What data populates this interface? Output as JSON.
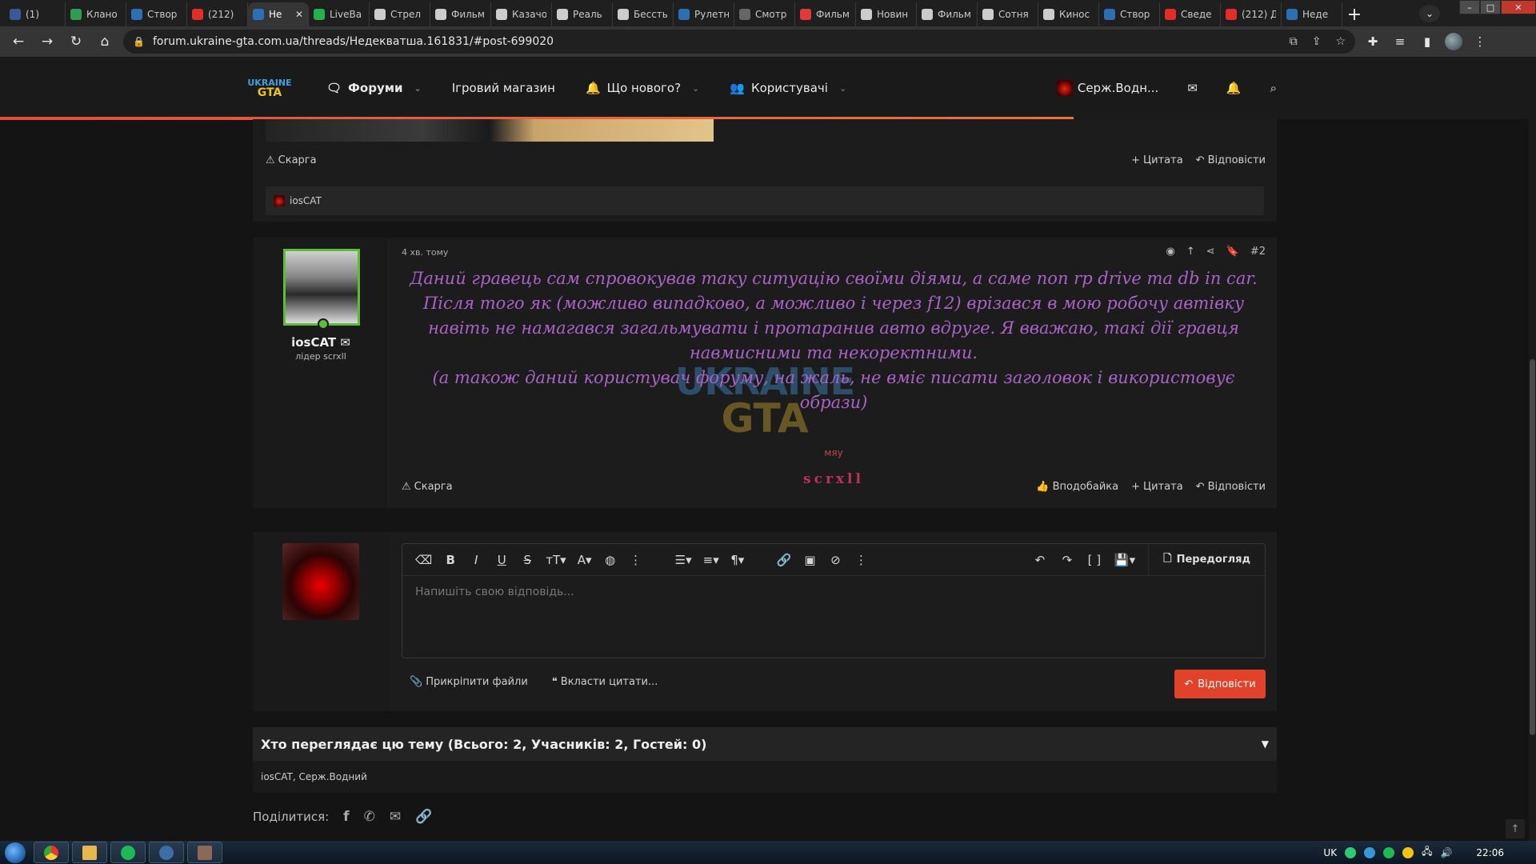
{
  "browser": {
    "tabs": [
      {
        "label": "(1)",
        "color": "#3b5998"
      },
      {
        "label": "Клано",
        "color": "#2e9d4f"
      },
      {
        "label": "Створ",
        "color": "#2b6fb5"
      },
      {
        "label": "(212)",
        "color": "#e52d27"
      },
      {
        "label": "Не",
        "color": "#2b6fb5",
        "active": true
      },
      {
        "label": "LiveBa",
        "color": "#22b14c"
      },
      {
        "label": "Стрел",
        "color": "#cccccc"
      },
      {
        "label": "Фильм",
        "color": "#cccccc"
      },
      {
        "label": "Казачо",
        "color": "#cccccc"
      },
      {
        "label": "Реаль",
        "color": "#cccccc"
      },
      {
        "label": "Бессть",
        "color": "#cccccc"
      },
      {
        "label": "Рулетн",
        "color": "#2b6fb5"
      },
      {
        "label": "Смотр",
        "color": "#666666"
      },
      {
        "label": "Фильм",
        "color": "#e5383b"
      },
      {
        "label": "Новин",
        "color": "#cccccc"
      },
      {
        "label": "Фильм",
        "color": "#cccccc"
      },
      {
        "label": "Сотня",
        "color": "#cccccc"
      },
      {
        "label": "Кинос",
        "color": "#cccccc"
      },
      {
        "label": "Створ",
        "color": "#2b6fb5"
      },
      {
        "label": "Сведе",
        "color": "#e52d27"
      },
      {
        "label": "(212) Д",
        "color": "#e52d27"
      },
      {
        "label": "Неде",
        "color": "#2b6fb5"
      }
    ],
    "url": "forum.ukraine-gta.com.ua/threads/Недекватша.161831/#post-699020"
  },
  "site": {
    "logo_top": "UKRAINE",
    "logo_bottom": "GTA",
    "nav": {
      "forums": "Форуми",
      "shop": "Ігровий магазин",
      "whats_new": "Що нового?",
      "members": "Користувачі"
    },
    "user_name": "Серж.Водн..."
  },
  "prev_post": {
    "report": "Скарга",
    "quote": "Цитата",
    "reply": "Відповісти",
    "liked_by": "iosCAT"
  },
  "post2": {
    "author": "iosCAT",
    "role": "лідер scrxll",
    "time": "4 хв. тому",
    "number": "#2",
    "text": "Даний гравець сам спровокував таку ситуацію своїми діями, а саме non rp drive та db in car. Після того як (можливо випадково, а можливо і через f12) врізався в мою робочу автівку навіть не намагався загальмувати і протаранив авто вдруге. Я вважаю, такі дії гравця навмисними та некоректними.",
    "text2": "(а також даний користувач форуму, на жаль, не вміє писати заголовок і використовує образи)",
    "sig1": "мяу",
    "sig2": "scrxll",
    "watermark_top": "UKRAINE",
    "watermark_bottom": "GTA",
    "report": "Скарга",
    "like": "Вподобайка",
    "quote": "Цитата",
    "reply": "Відповісти"
  },
  "editor": {
    "placeholder": "Напишіть свою відповідь...",
    "preview": "Передогляд",
    "attach": "Прикріпити файли",
    "insert_quotes": "Вкласти цитати...",
    "submit": "Відповісти"
  },
  "viewers": {
    "title": "Хто переглядає цю тему (Всього: 2, Учасників: 2, Гостей: 0)",
    "list": "iosCAT, Серж.Водний"
  },
  "share": {
    "label": "Поділитися:"
  },
  "taskbar": {
    "lang": "UK",
    "time": "22:06"
  },
  "colors": {
    "accent": "#e2412a",
    "post_text": "#a763c6",
    "online": "#5cbd3b"
  }
}
